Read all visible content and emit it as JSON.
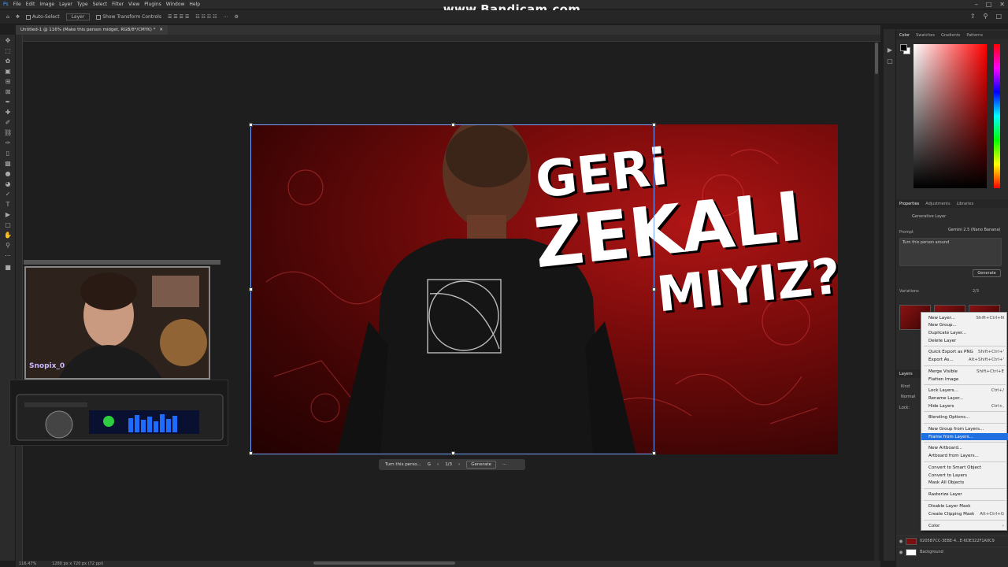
{
  "menubar": {
    "items": [
      "File",
      "Edit",
      "Image",
      "Layer",
      "Type",
      "Select",
      "Filter",
      "View",
      "Plugins",
      "Window",
      "Help"
    ]
  },
  "watermark": "www.Bandicam.com",
  "options": {
    "auto_select": "Auto-Select",
    "layer_select": "Layer",
    "transform": "Show Transform Controls"
  },
  "document": {
    "tab_title": "Untitled-1 @ 116% (Make this person midget, RGB/8*/CMYK) *"
  },
  "thumbnail": {
    "line1": "GERi",
    "line2": "ZEKALI",
    "line3": "MIYIZ?"
  },
  "contextbar": {
    "prompt": "Turn this perso...",
    "counter": "1/3",
    "generate": "Generate"
  },
  "status": {
    "zoom": "116.47%",
    "size": "1280 px x 720 px (72 ppi)"
  },
  "webcam": {
    "label": "Snopix_0"
  },
  "color_panel": {
    "tabs": [
      "Color",
      "Swatches",
      "Gradients",
      "Patterns"
    ]
  },
  "properties_panel": {
    "tabs": [
      "Properties",
      "Adjustments",
      "Libraries"
    ],
    "layer_type": "Generative Layer",
    "prompt_label": "Prompt",
    "model": "Gemini 2.5 (Nano Banana)",
    "prompt_text": "Turn this person around",
    "generate": "Generate",
    "variations_label": "Variations",
    "variation_count": "2/3"
  },
  "layers_panel": {
    "tab": "Layers",
    "kind": "Kind",
    "blend": "Normal",
    "lock": "Lock:",
    "layer_id": "0205B7CC-3EBE-4...E-6DE322F1A0C9",
    "background": "Background"
  },
  "context_menu": {
    "items": [
      {
        "label": "New Layer...",
        "shortcut": "Shift+Ctrl+N"
      },
      {
        "label": "New Group...",
        "shortcut": ""
      },
      {
        "label": "Duplicate Layer...",
        "shortcut": ""
      },
      {
        "label": "Delete Layer",
        "shortcut": ""
      },
      {
        "label": "Quick Export as PNG",
        "shortcut": "Shift+Ctrl+'"
      },
      {
        "label": "Export As...",
        "shortcut": "Alt+Shift+Ctrl+'"
      },
      {
        "label": "Merge Visible",
        "shortcut": "Shift+Ctrl+E"
      },
      {
        "label": "Flatten Image",
        "shortcut": ""
      },
      {
        "label": "Lock Layers...",
        "shortcut": "Ctrl+/"
      },
      {
        "label": "Rename Layer...",
        "shortcut": ""
      },
      {
        "label": "Hide Layers",
        "shortcut": "Ctrl+,"
      },
      {
        "label": "Blending Options...",
        "shortcut": ""
      },
      {
        "label": "New Group from Layers...",
        "shortcut": ""
      },
      {
        "label": "Frame from Layers...",
        "shortcut": ""
      },
      {
        "label": "New Artboard...",
        "shortcut": ""
      },
      {
        "label": "Artboard from Layers...",
        "shortcut": ""
      },
      {
        "label": "Convert to Smart Object",
        "shortcut": ""
      },
      {
        "label": "Convert to Layers",
        "shortcut": ""
      },
      {
        "label": "Mask All Objects",
        "shortcut": ""
      },
      {
        "label": "Rasterize Layer",
        "shortcut": ""
      },
      {
        "label": "Disable Layer Mask",
        "shortcut": ""
      },
      {
        "label": "Create Clipping Mask",
        "shortcut": "Alt+Ctrl+G"
      },
      {
        "label": "Color",
        "shortcut": "›"
      }
    ]
  }
}
